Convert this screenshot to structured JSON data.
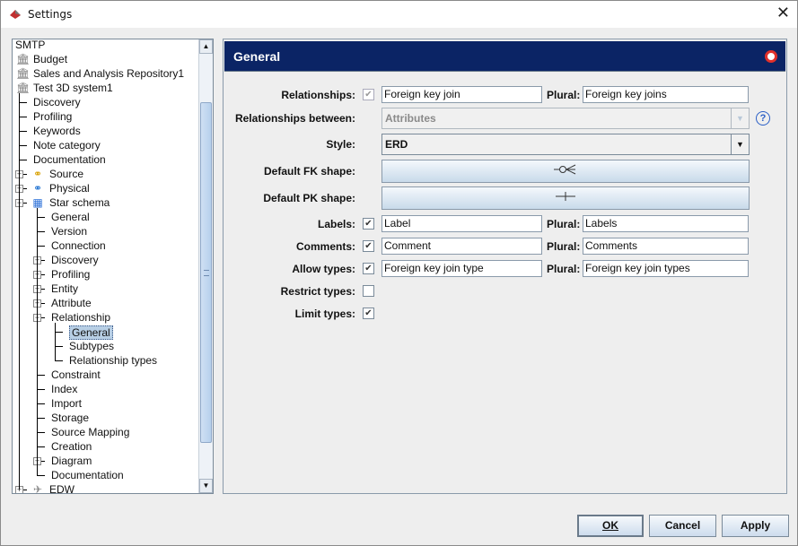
{
  "window": {
    "title": "Settings",
    "close_icon": "close-icon",
    "app_icon": "app-logo-icon"
  },
  "tree": {
    "items": [
      {
        "label": "SMTP",
        "level": 0,
        "icon": "none"
      },
      {
        "label": "Budget",
        "level": 0,
        "icon": "bank-icon"
      },
      {
        "label": "Sales and Analysis Repository1",
        "level": 0,
        "icon": "bank-icon"
      },
      {
        "label": "Test 3D system1",
        "level": 0,
        "icon": "bank-icon"
      },
      {
        "label": "Discovery",
        "level": 1
      },
      {
        "label": "Profiling",
        "level": 1
      },
      {
        "label": "Keywords",
        "level": 1
      },
      {
        "label": "Note category",
        "level": 1
      },
      {
        "label": "Documentation",
        "level": 1
      },
      {
        "label": "Source",
        "level": 1,
        "icon": "source-model-icon",
        "expander": "+"
      },
      {
        "label": "Physical",
        "level": 1,
        "icon": "physical-model-icon",
        "expander": "+"
      },
      {
        "label": "Star schema",
        "level": 1,
        "icon": "star-schema-icon",
        "expander": "-"
      },
      {
        "label": "General",
        "level": 2
      },
      {
        "label": "Version",
        "level": 2
      },
      {
        "label": "Connection",
        "level": 2
      },
      {
        "label": "Discovery",
        "level": 2,
        "expander": "+"
      },
      {
        "label": "Profiling",
        "level": 2,
        "expander": "+"
      },
      {
        "label": "Entity",
        "level": 2,
        "expander": "+"
      },
      {
        "label": "Attribute",
        "level": 2,
        "expander": "+"
      },
      {
        "label": "Relationship",
        "level": 2,
        "expander": "-"
      },
      {
        "label": "General",
        "level": 3,
        "selected": true
      },
      {
        "label": "Subtypes",
        "level": 3
      },
      {
        "label": "Relationship types",
        "level": 3
      },
      {
        "label": "Constraint",
        "level": 2
      },
      {
        "label": "Index",
        "level": 2
      },
      {
        "label": "Import",
        "level": 2
      },
      {
        "label": "Storage",
        "level": 2
      },
      {
        "label": "Source Mapping",
        "level": 2
      },
      {
        "label": "Creation",
        "level": 2
      },
      {
        "label": "Diagram",
        "level": 2,
        "expander": "+"
      },
      {
        "label": "Documentation",
        "level": 2
      },
      {
        "label": "EDW",
        "level": 1,
        "icon": "edw-model-icon",
        "expander": "+"
      }
    ]
  },
  "panel": {
    "title": "General",
    "relationships": {
      "label": "Relationships:",
      "checked": true,
      "disabled": true,
      "value": "Foreign key join",
      "plural_label": "Plural:",
      "plural": "Foreign key joins"
    },
    "relationships_between": {
      "label": "Relationships between:",
      "value": "Attributes",
      "help": "?"
    },
    "style": {
      "label": "Style:",
      "value": "ERD"
    },
    "fk_shape": {
      "label": "Default FK shape:",
      "glyph": "-o<"
    },
    "pk_shape": {
      "label": "Default PK shape:",
      "glyph": "—+—"
    },
    "labels": {
      "label": "Labels:",
      "checked": true,
      "value": "Label",
      "plural_label": "Plural:",
      "plural": "Labels"
    },
    "comments": {
      "label": "Comments:",
      "checked": true,
      "value": "Comment",
      "plural_label": "Plural:",
      "plural": "Comments"
    },
    "allow_types": {
      "label": "Allow types:",
      "checked": true,
      "value": "Foreign key join type",
      "plural_label": "Plural:",
      "plural": "Foreign key join types"
    },
    "restrict_types": {
      "label": "Restrict types:",
      "checked": false
    },
    "limit_types": {
      "label": "Limit types:",
      "checked": true
    }
  },
  "buttons": {
    "ok": "OK",
    "cancel": "Cancel",
    "apply": "Apply"
  },
  "colors": {
    "header_bg": "#0b2465",
    "selection": "#b8cfe5"
  }
}
